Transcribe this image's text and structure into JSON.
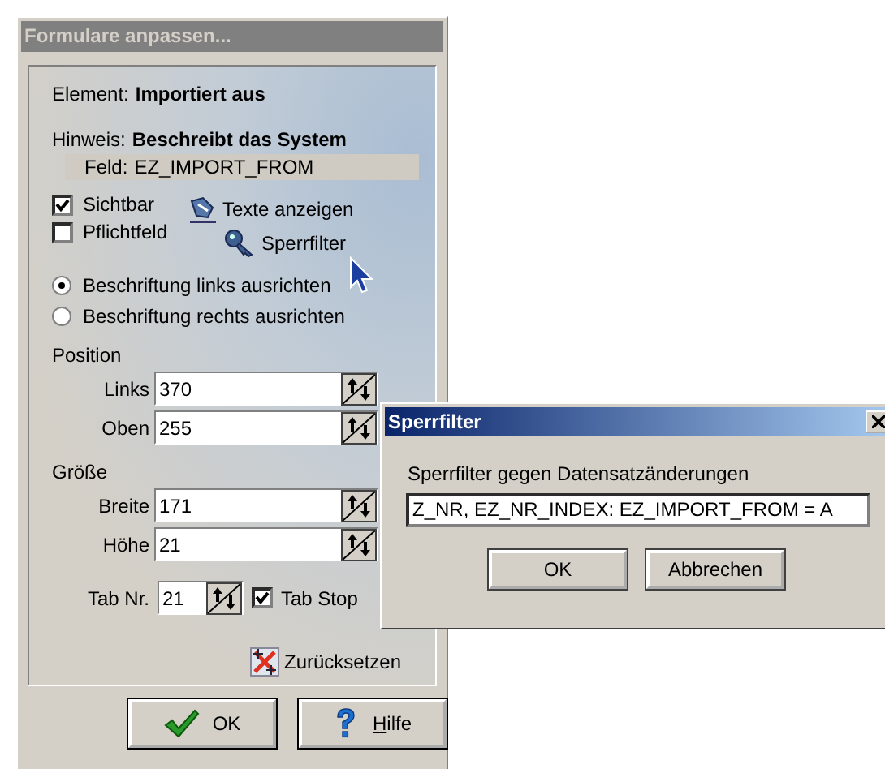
{
  "main_window": {
    "title": "Formulare anpassen...",
    "element": {
      "label": "Element:",
      "value": "Importiert aus"
    },
    "hint": {
      "label": "Hinweis:",
      "value": "Beschreibt das System"
    },
    "field": {
      "label": "Feld:",
      "value": "EZ_IMPORT_FROM"
    },
    "checkboxes": [
      {
        "label": "Sichtbar",
        "checked": true
      },
      {
        "label": "Pflichtfeld",
        "checked": false
      }
    ],
    "links": [
      {
        "label": "Texte anzeigen",
        "kind": "texts"
      },
      {
        "label": "Sperrfilter",
        "kind": "filter"
      }
    ],
    "alignment": [
      {
        "label": "Beschriftung links ausrichten",
        "selected": true
      },
      {
        "label": "Beschriftung rechts ausrichten",
        "selected": false
      }
    ],
    "groups": [
      {
        "heading": "Position",
        "fields": [
          {
            "label": "Links",
            "value": "370"
          },
          {
            "label": "Oben",
            "value": "255"
          }
        ]
      },
      {
        "heading": "Größe",
        "fields": [
          {
            "label": "Breite",
            "value": "171"
          },
          {
            "label": "Höhe",
            "value": "21"
          }
        ]
      }
    ],
    "tab": {
      "label": "Tab Nr.",
      "value": "21",
      "stop_label": "Tab Stop",
      "stop_checked": true
    },
    "reset": "Zurücksetzen",
    "buttons": [
      {
        "label": "OK",
        "kind": "ok"
      },
      {
        "label": "Hilfe",
        "kind": "help"
      }
    ]
  },
  "dialog": {
    "title": "Sperrfilter",
    "prompt": "Sperrfilter gegen Datensatzänderungen",
    "value": "Z_NR, EZ_NR_INDEX: EZ_IMPORT_FROM = A",
    "buttons": [
      "OK",
      "Abbrechen"
    ]
  }
}
